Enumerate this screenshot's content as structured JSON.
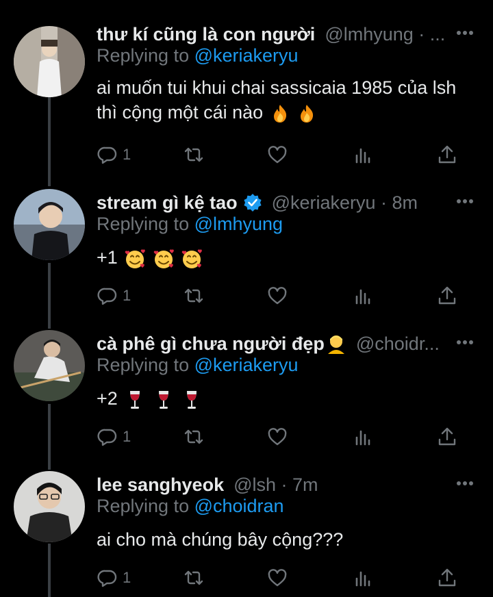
{
  "tweets": [
    {
      "name": "thư kí cũng là con người",
      "verified": false,
      "handle": "@lmhyung · ...",
      "replying_prefix": "Replying to ",
      "replying_to": "@keriakeryu",
      "text": "ai muốn tui khui chai sassicaia 1985 của lsh thì cộng một cái nào",
      "text_emoji": [
        "fire",
        "fire"
      ],
      "reply_count": "1"
    },
    {
      "name": "stream gì kệ tao",
      "verified": true,
      "handle": "@keriakeryu · 8m",
      "replying_prefix": "Replying to ",
      "replying_to": "@lmhyung",
      "text": "+1",
      "text_emoji": [
        "smiling-face-with-hearts",
        "smiling-face-with-hearts",
        "smiling-face-with-hearts"
      ],
      "reply_count": "1"
    },
    {
      "name": "cà phê gì chưa người đẹp",
      "verified": false,
      "handle": "@choidr...",
      "replying_prefix": "Replying to ",
      "replying_to": "@keriakeryu",
      "text": "+2",
      "text_emoji": [
        "wine-glass",
        "wine-glass",
        "wine-glass"
      ],
      "reply_count": "1"
    },
    {
      "name": "lee sanghyeok",
      "verified": false,
      "handle": "@lsh · 7m",
      "replying_prefix": "Replying to ",
      "replying_to": "@choidran",
      "text": "ai cho mà chúng bây cộng???",
      "text_emoji": [],
      "reply_count": "1"
    }
  ],
  "colors": {
    "background": "#000000",
    "text": "#e7e9ea",
    "muted": "#71767b",
    "link": "#1d9bf0",
    "thread_line": "#3a3f44"
  },
  "icons": [
    "reply-icon",
    "retweet-icon",
    "like-icon",
    "views-icon",
    "share-icon",
    "more-icon",
    "verified-badge-icon"
  ]
}
